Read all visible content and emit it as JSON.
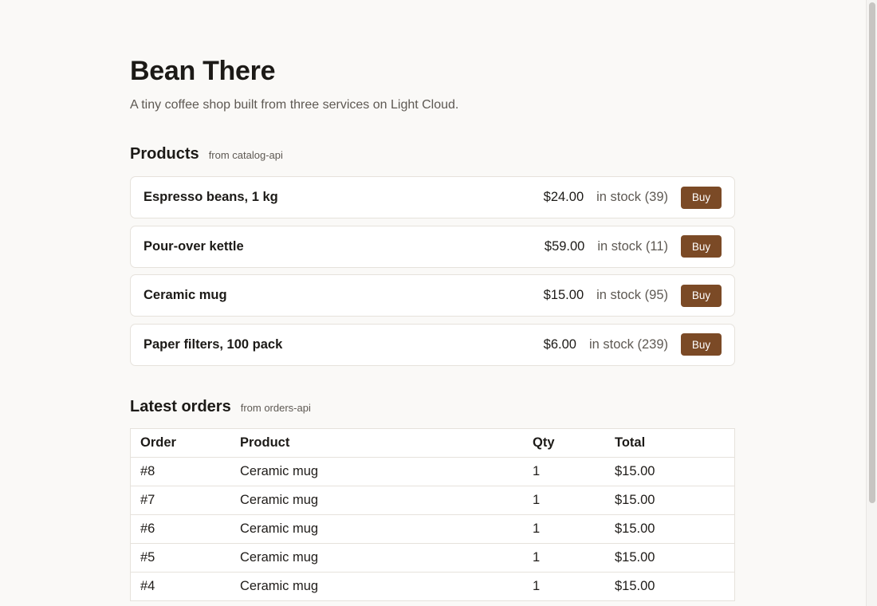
{
  "header": {
    "title": "Bean There",
    "tagline": "A tiny coffee shop built from three services on Light Cloud."
  },
  "products": {
    "heading": "Products",
    "source": "from catalog-api",
    "buy_label": "Buy",
    "items": [
      {
        "name": "Espresso beans, 1 kg",
        "price": "$24.00",
        "stock": "in stock (39)"
      },
      {
        "name": "Pour-over kettle",
        "price": "$59.00",
        "stock": "in stock (11)"
      },
      {
        "name": "Ceramic mug",
        "price": "$15.00",
        "stock": "in stock (95)"
      },
      {
        "name": "Paper filters, 100 pack",
        "price": "$6.00",
        "stock": "in stock (239)"
      }
    ]
  },
  "orders": {
    "heading": "Latest orders",
    "source": "from orders-api",
    "columns": [
      "Order",
      "Product",
      "Qty",
      "Total"
    ],
    "rows": [
      [
        "#8",
        "Ceramic mug",
        "1",
        "$15.00"
      ],
      [
        "#7",
        "Ceramic mug",
        "1",
        "$15.00"
      ],
      [
        "#6",
        "Ceramic mug",
        "1",
        "$15.00"
      ],
      [
        "#5",
        "Ceramic mug",
        "1",
        "$15.00"
      ],
      [
        "#4",
        "Ceramic mug",
        "1",
        "$15.00"
      ]
    ]
  },
  "theme": {
    "accent": "#7b4a26",
    "background": "#faf9f7",
    "text": "#1c1a17",
    "muted": "#5e5953",
    "border": "#e6e2dc"
  }
}
